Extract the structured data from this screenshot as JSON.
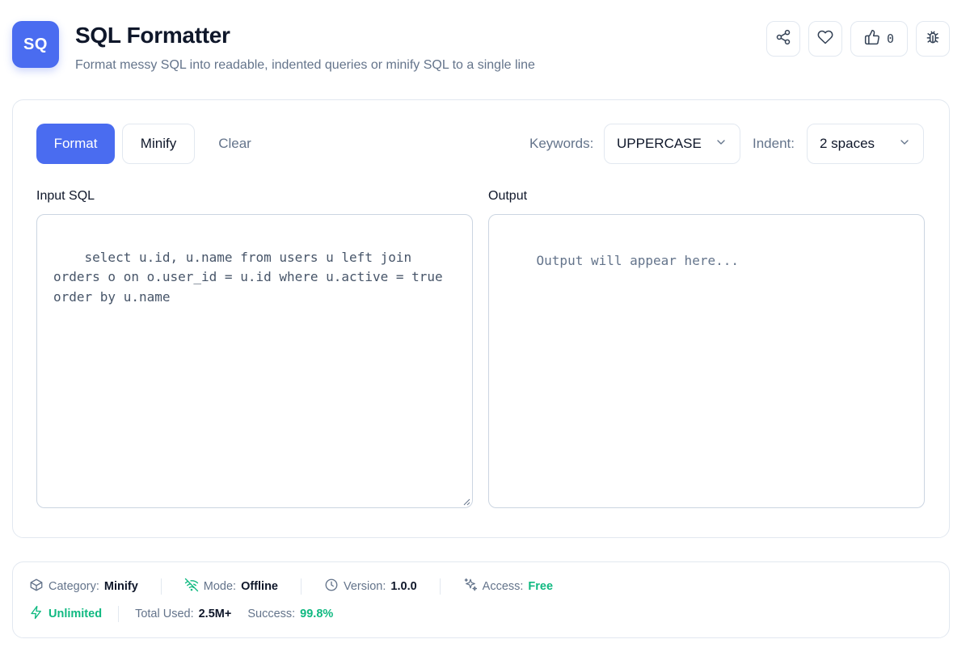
{
  "header": {
    "app_icon_text": "SQ",
    "title": "SQL Formatter",
    "subtitle": "Format messy SQL into readable, indented queries or minify SQL to a single line",
    "like_count": "0"
  },
  "toolbar": {
    "format_label": "Format",
    "minify_label": "Minify",
    "clear_label": "Clear",
    "keywords_label": "Keywords:",
    "keywords_value": "UPPERCASE",
    "indent_label": "Indent:",
    "indent_value": "2 spaces"
  },
  "editor": {
    "input_label": "Input SQL",
    "input_value": "select u.id, u.name from users u left join orders o on o.user_id = u.id where u.active = true order by u.name",
    "output_label": "Output",
    "output_placeholder": "Output will appear here..."
  },
  "footer": {
    "category_key": "Category:",
    "category_value": "Minify",
    "mode_key": "Mode:",
    "mode_value": "Offline",
    "version_key": "Version:",
    "version_value": "1.0.0",
    "access_key": "Access:",
    "access_value": "Free",
    "unlimited_label": "Unlimited",
    "total_used_key": "Total Used:",
    "total_used_value": "2.5M+",
    "success_key": "Success:",
    "success_value": "99.8%"
  },
  "colors": {
    "accent": "#4a6cf0",
    "success_green": "#10b981",
    "muted_text": "#64748b",
    "border": "#e2e8f0"
  },
  "icons": [
    "share-icon",
    "heart-icon",
    "thumbs-up-icon",
    "bug-icon",
    "chevron-down-icon",
    "box-icon",
    "wifi-off-icon",
    "clock-icon",
    "sparkles-icon",
    "bolt-icon"
  ]
}
